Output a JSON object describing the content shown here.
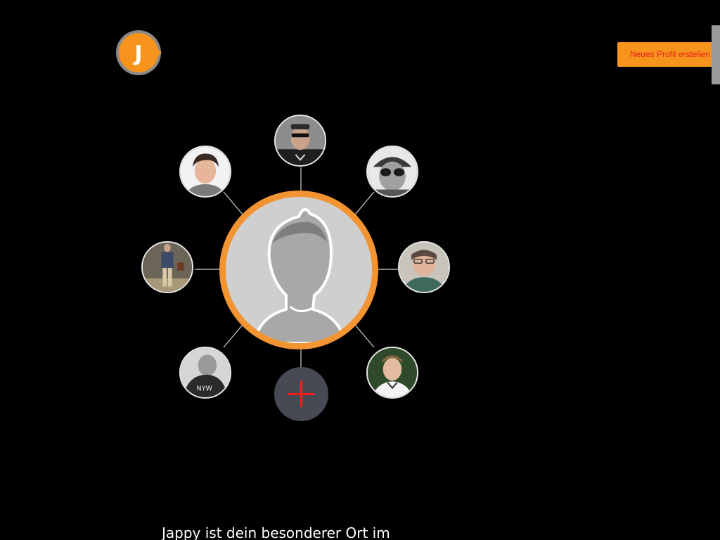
{
  "header": {
    "logo_letter": "J",
    "signup_button_label": "Neues Profil erstellen"
  },
  "network": {
    "center_avatar": "default-profile-silhouette",
    "member_avatars": [
      "member-photo-sunglasses-cap",
      "member-photo-beanie-sunglasses",
      "member-photo-glasses-woman",
      "member-photo-young-man",
      "member-photo-man-hoodie",
      "member-photo-man-standing",
      "member-photo-woman-short-hair"
    ],
    "add_button_icon": "plus-icon"
  },
  "intro": {
    "text": "Jappy ist dein besonderer Ort im"
  },
  "colors": {
    "background": "#000000",
    "accent_orange": "#f29431",
    "button_orange": "#f7941d",
    "button_text_red": "#e8231b",
    "plus_red": "#ff1a1a",
    "add_button_bg": "#474a55"
  }
}
